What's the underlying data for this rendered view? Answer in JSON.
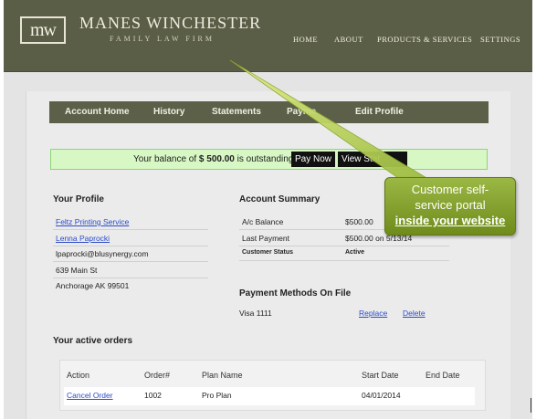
{
  "brand": {
    "logo_text": "mw",
    "name": "MANES WINCHESTER",
    "subtitle": "FAMILY LAW FIRM"
  },
  "topnav": [
    "HOME",
    "ABOUT",
    "PRODUCTS & SERVICES",
    "SETTINGS"
  ],
  "subnav": [
    "Account Home",
    "History",
    "Statements",
    "Payme",
    "Edit Profile"
  ],
  "balance": {
    "prefix": "Your balance of",
    "amount": "$ 500.00",
    "suffix": "is outstanding",
    "pay_now": "Pay Now",
    "view_statement": "View Stat"
  },
  "profile": {
    "heading": "Your Profile",
    "company": "Feltz Printing Service",
    "name": "Lenna Paprocki",
    "email": "lpaprocki@blusynergy.com",
    "street": "639 Main St",
    "city": "Anchorage AK 99501"
  },
  "account_summary": {
    "heading": "Account Summary",
    "rows": [
      {
        "label": "A/c Balance",
        "value": "$500.00"
      },
      {
        "label": "Last Payment",
        "value": "$500.00 on 5/13/14"
      },
      {
        "label": "Customer Status",
        "value": "Active"
      }
    ]
  },
  "payment_methods": {
    "heading": "Payment Methods On File",
    "card": "Visa 1111",
    "replace": "Replace",
    "delete": "Delete"
  },
  "orders": {
    "heading": "Your active orders",
    "columns": [
      "Action",
      "Order#",
      "Plan Name",
      "Start Date",
      "End Date"
    ],
    "rows": [
      {
        "action": "Cancel Order",
        "order": "1002",
        "plan": "Pro Plan",
        "start": "04/01/2014",
        "end": ""
      }
    ]
  },
  "callout": {
    "line1": "Customer self-",
    "line2": "service portal",
    "line3": "inside your website"
  },
  "colors": {
    "header_bg": "#5b5e47",
    "subnav_bg": "#5d6049",
    "balance_bg": "#d7f7c4",
    "callout_green": "#8aa834",
    "link": "#2b4bc9"
  }
}
